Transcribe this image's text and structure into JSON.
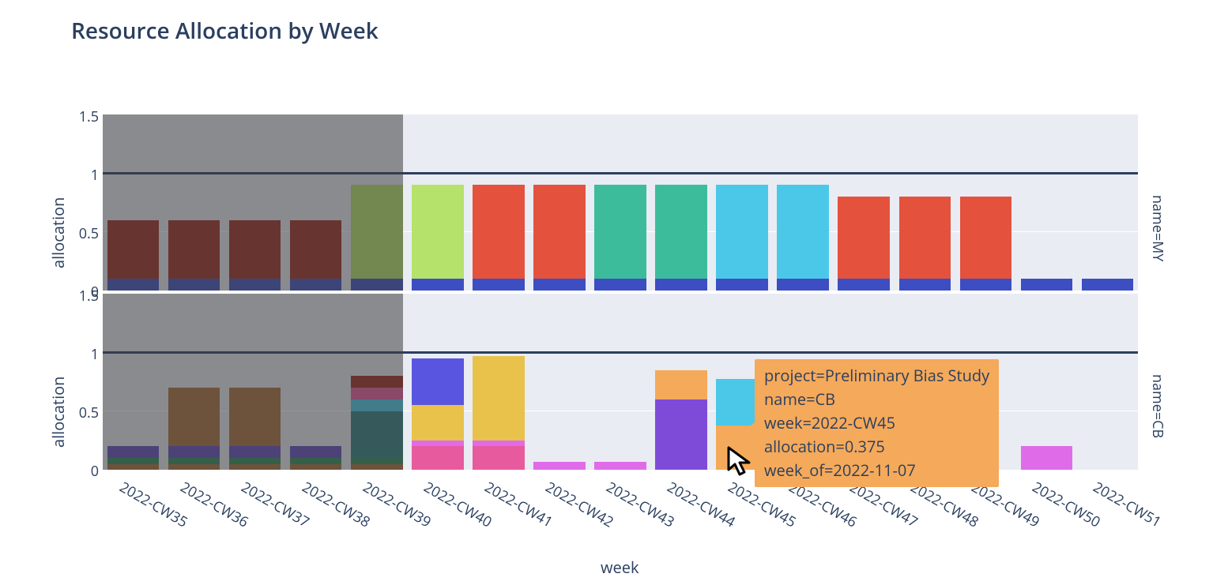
{
  "title": "Resource Allocation by Week",
  "xlabel": "week",
  "ylabel": "allocation",
  "facets": {
    "my": "name=MY",
    "cb": "name=CB"
  },
  "yticks": [
    "0",
    "0.5",
    "1",
    "1.5"
  ],
  "tooltip": {
    "l1": "project=Preliminary Bias Study",
    "l2": "name=CB",
    "l3": "week=2022-CW45",
    "l4": "allocation=0.375",
    "l5": "week_of=2022-11-07"
  },
  "chart_data": {
    "type": "bar",
    "stacked": true,
    "faceted_by": "name",
    "x_field": "week",
    "y_field": "allocation",
    "ylim": [
      0,
      1.5
    ],
    "reference_line": 1.0,
    "shaded_region_weeks": [
      "2022-CW35",
      "2022-CW36",
      "2022-CW37",
      "2022-CW38",
      "2022-CW39"
    ],
    "categories": [
      "2022-CW35",
      "2022-CW36",
      "2022-CW37",
      "2022-CW38",
      "2022-CW39",
      "2022-CW40",
      "2022-CW41",
      "2022-CW42",
      "2022-CW43",
      "2022-CW44",
      "2022-CW45",
      "2022-CW46",
      "2022-CW47",
      "2022-CW48",
      "2022-CW49",
      "2022-CW50",
      "2022-CW51"
    ],
    "colors": {
      "blue": "#3c4ec2",
      "darkred": "#9e2b1f",
      "lime": "#b5e26b",
      "red": "#e4523e",
      "teal": "#3cbc9a",
      "cyan": "#4bc8e8",
      "brown": "#a86f3c",
      "purple": "#614bc2",
      "green": "#2f8a5b",
      "dkteal": "#2f7e84",
      "violet": "#7e4bd8",
      "indigo": "#5a55e0",
      "pink": "#e85a9e",
      "gold": "#e8c24b",
      "magenta": "#e06be8",
      "orange": "#f5a95a"
    },
    "facet_data": {
      "MY": [
        {
          "week": "2022-CW35",
          "stack": [
            {
              "c": "blue",
              "v": 0.1
            },
            {
              "c": "darkred",
              "v": 0.5
            }
          ]
        },
        {
          "week": "2022-CW36",
          "stack": [
            {
              "c": "blue",
              "v": 0.1
            },
            {
              "c": "darkred",
              "v": 0.5
            }
          ]
        },
        {
          "week": "2022-CW37",
          "stack": [
            {
              "c": "blue",
              "v": 0.1
            },
            {
              "c": "darkred",
              "v": 0.5
            }
          ]
        },
        {
          "week": "2022-CW38",
          "stack": [
            {
              "c": "blue",
              "v": 0.1
            },
            {
              "c": "darkred",
              "v": 0.5
            }
          ]
        },
        {
          "week": "2022-CW39",
          "stack": [
            {
              "c": "blue",
              "v": 0.1
            },
            {
              "c": "lime",
              "v": 0.8
            }
          ]
        },
        {
          "week": "2022-CW40",
          "stack": [
            {
              "c": "blue",
              "v": 0.1
            },
            {
              "c": "lime",
              "v": 0.8
            }
          ]
        },
        {
          "week": "2022-CW41",
          "stack": [
            {
              "c": "blue",
              "v": 0.1
            },
            {
              "c": "red",
              "v": 0.8
            }
          ]
        },
        {
          "week": "2022-CW42",
          "stack": [
            {
              "c": "blue",
              "v": 0.1
            },
            {
              "c": "red",
              "v": 0.8
            }
          ]
        },
        {
          "week": "2022-CW43",
          "stack": [
            {
              "c": "blue",
              "v": 0.1
            },
            {
              "c": "teal",
              "v": 0.8
            }
          ]
        },
        {
          "week": "2022-CW44",
          "stack": [
            {
              "c": "blue",
              "v": 0.1
            },
            {
              "c": "teal",
              "v": 0.8
            }
          ]
        },
        {
          "week": "2022-CW45",
          "stack": [
            {
              "c": "blue",
              "v": 0.1
            },
            {
              "c": "cyan",
              "v": 0.8
            }
          ]
        },
        {
          "week": "2022-CW46",
          "stack": [
            {
              "c": "blue",
              "v": 0.1
            },
            {
              "c": "cyan",
              "v": 0.8
            }
          ]
        },
        {
          "week": "2022-CW47",
          "stack": [
            {
              "c": "blue",
              "v": 0.1
            },
            {
              "c": "red",
              "v": 0.7
            }
          ]
        },
        {
          "week": "2022-CW48",
          "stack": [
            {
              "c": "blue",
              "v": 0.1
            },
            {
              "c": "red",
              "v": 0.7
            }
          ]
        },
        {
          "week": "2022-CW49",
          "stack": [
            {
              "c": "blue",
              "v": 0.1
            },
            {
              "c": "red",
              "v": 0.7
            }
          ]
        },
        {
          "week": "2022-CW50",
          "stack": [
            {
              "c": "blue",
              "v": 0.1
            }
          ]
        },
        {
          "week": "2022-CW51",
          "stack": [
            {
              "c": "blue",
              "v": 0.1
            }
          ]
        }
      ],
      "CB": [
        {
          "week": "2022-CW35",
          "stack": [
            {
              "c": "brown",
              "v": 0.05
            },
            {
              "c": "green",
              "v": 0.05
            },
            {
              "c": "purple",
              "v": 0.1
            }
          ]
        },
        {
          "week": "2022-CW36",
          "stack": [
            {
              "c": "brown",
              "v": 0.05
            },
            {
              "c": "green",
              "v": 0.05
            },
            {
              "c": "purple",
              "v": 0.1
            },
            {
              "c": "brown",
              "v": 0.5
            }
          ]
        },
        {
          "week": "2022-CW37",
          "stack": [
            {
              "c": "brown",
              "v": 0.05
            },
            {
              "c": "green",
              "v": 0.05
            },
            {
              "c": "purple",
              "v": 0.1
            },
            {
              "c": "brown",
              "v": 0.5
            }
          ]
        },
        {
          "week": "2022-CW38",
          "stack": [
            {
              "c": "brown",
              "v": 0.05
            },
            {
              "c": "green",
              "v": 0.05
            },
            {
              "c": "purple",
              "v": 0.1
            }
          ]
        },
        {
          "week": "2022-CW39",
          "stack": [
            {
              "c": "brown",
              "v": 0.05
            },
            {
              "c": "green",
              "v": 0.05
            },
            {
              "c": "dkteal",
              "v": 0.4
            },
            {
              "c": "cyan",
              "v": 0.1
            },
            {
              "c": "pink",
              "v": 0.1
            },
            {
              "c": "darkred",
              "v": 0.1
            }
          ]
        },
        {
          "week": "2022-CW40",
          "stack": [
            {
              "c": "pink",
              "v": 0.2
            },
            {
              "c": "magenta",
              "v": 0.05
            },
            {
              "c": "gold",
              "v": 0.3
            },
            {
              "c": "indigo",
              "v": 0.4
            }
          ]
        },
        {
          "week": "2022-CW41",
          "stack": [
            {
              "c": "pink",
              "v": 0.2
            },
            {
              "c": "magenta",
              "v": 0.05
            },
            {
              "c": "gold",
              "v": 0.72
            }
          ]
        },
        {
          "week": "2022-CW42",
          "stack": [
            {
              "c": "magenta",
              "v": 0.07
            }
          ]
        },
        {
          "week": "2022-CW43",
          "stack": [
            {
              "c": "magenta",
              "v": 0.07
            }
          ]
        },
        {
          "week": "2022-CW44",
          "stack": [
            {
              "c": "violet",
              "v": 0.6
            },
            {
              "c": "orange",
              "v": 0.25
            }
          ]
        },
        {
          "week": "2022-CW45",
          "stack": [
            {
              "c": "orange",
              "v": 0.375
            },
            {
              "c": "cyan",
              "v": 0.4
            }
          ]
        },
        {
          "week": "2022-CW46",
          "stack": []
        },
        {
          "week": "2022-CW47",
          "stack": []
        },
        {
          "week": "2022-CW48",
          "stack": []
        },
        {
          "week": "2022-CW49",
          "stack": []
        },
        {
          "week": "2022-CW50",
          "stack": [
            {
              "c": "magenta",
              "v": 0.2
            }
          ]
        },
        {
          "week": "2022-CW51",
          "stack": []
        }
      ]
    }
  }
}
